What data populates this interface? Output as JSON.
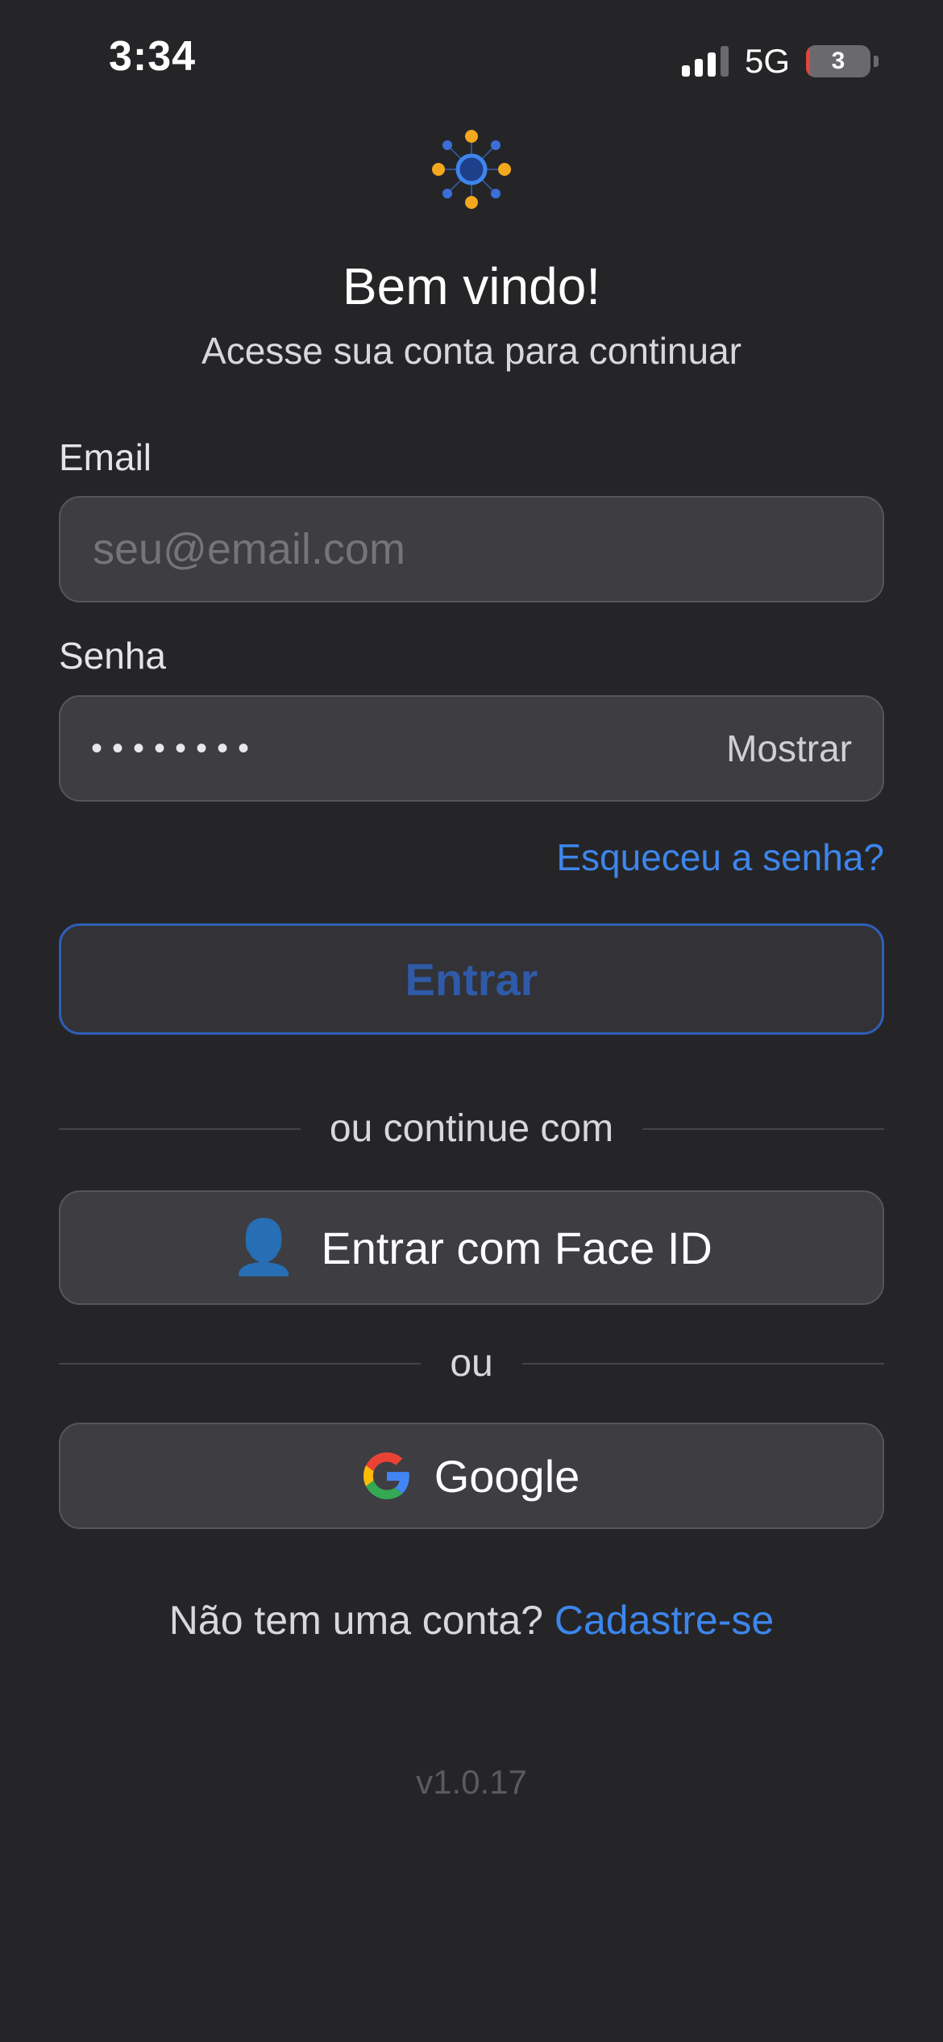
{
  "status_bar": {
    "time": "3:34",
    "network": "5G",
    "battery_level": "3",
    "battery_fraction": 0.03
  },
  "header": {
    "title": "Bem vindo!",
    "subtitle": "Acesse sua conta para continuar"
  },
  "form": {
    "email_label": "Email",
    "email_placeholder": "seu@email.com",
    "password_label": "Senha",
    "password_masked": "••••••••",
    "show_password_label": "Mostrar",
    "forgot_password_label": "Esqueceu a senha?",
    "submit_label": "Entrar"
  },
  "alt_login": {
    "divider_label": "ou continue com",
    "face_id_icon": "👤",
    "face_id_label": "Entrar com Face ID",
    "or_label": "ou",
    "google_label": "Google"
  },
  "footer": {
    "no_account_text": "Não tem uma conta?",
    "signup_label": "Cadastre-se",
    "version": "v1.0.17"
  },
  "colors": {
    "background": "#252528",
    "accent": "#3d86ec",
    "logo_blue": "#3a6fd8",
    "logo_orange": "#f4a81d"
  }
}
